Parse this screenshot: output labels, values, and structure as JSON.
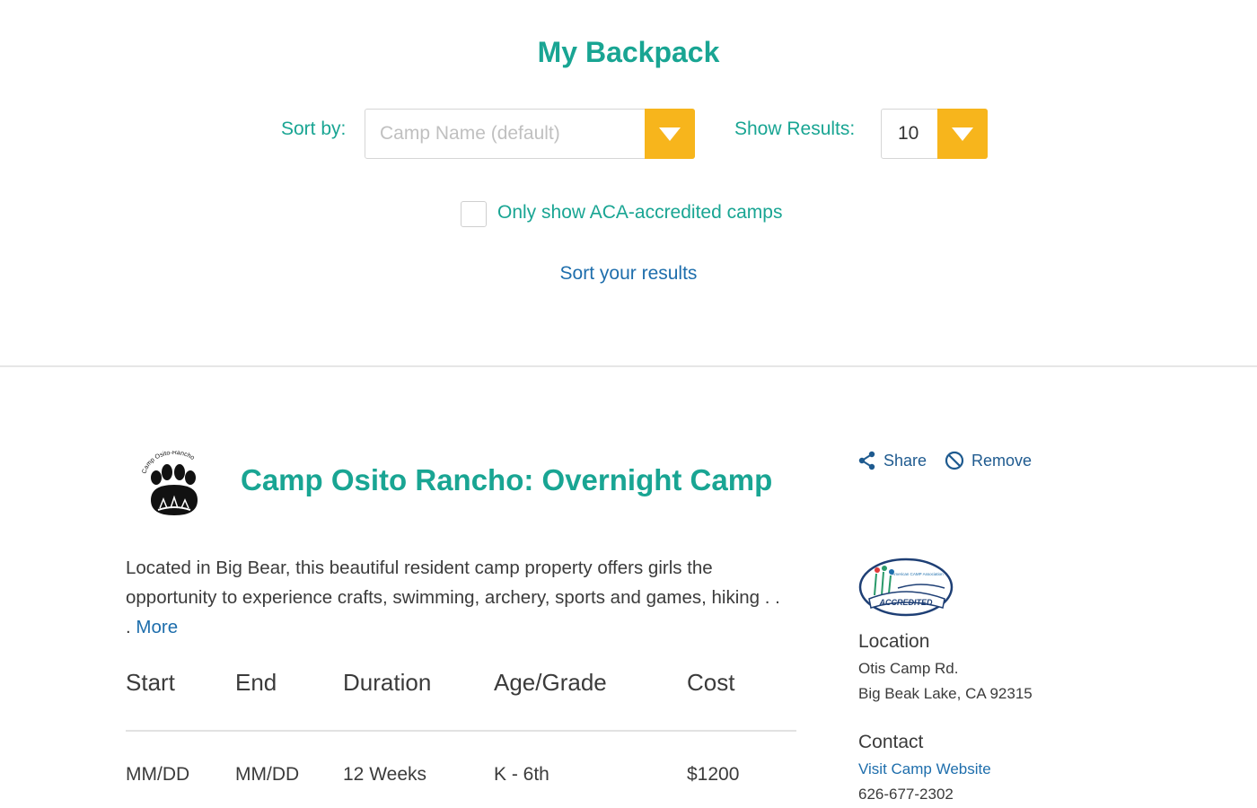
{
  "page": {
    "title": "My Backpack"
  },
  "controls": {
    "sort_label": "Sort by:",
    "sort_value": "Camp Name (default)",
    "results_label": "Show Results:",
    "results_value": "10",
    "checkbox_label": "Only show ACA-accredited camps",
    "checkbox_checked": false,
    "sort_link": "Sort your results",
    "dropdown_color": "#f7b51c"
  },
  "camp": {
    "logo_text": "Camp Osito-Rancho",
    "logo_icon": "bear-paw-logo",
    "title": "Camp Osito Rancho: Overnight Camp",
    "description": "Located in Big Bear, this beautiful resident camp property offers girls the opportunity to experience crafts, swimming, archery, sports and games, hiking . . . ",
    "more_label": "More",
    "actions": {
      "share_label": "Share",
      "remove_label": "Remove"
    },
    "table": {
      "headers": [
        "Start",
        "End",
        "Duration",
        "Age/Grade",
        "Cost"
      ],
      "rows": [
        [
          "MM/DD",
          "MM/DD",
          "12 Weeks",
          "K - 6th",
          "$1200"
        ]
      ]
    },
    "badge": {
      "top_text": "American CAMP Association",
      "bottom_text": "ACCREDITED"
    },
    "location": {
      "heading": "Location",
      "line1": "Otis Camp Rd.",
      "line2": "Big Beak Lake, CA 92315"
    },
    "contact": {
      "heading": "Contact",
      "website_label": "Visit Camp Website",
      "phone": "626-677-2302"
    }
  },
  "colors": {
    "teal": "#19a593",
    "link_blue": "#1e6eac",
    "accent": "#f7b51c"
  }
}
